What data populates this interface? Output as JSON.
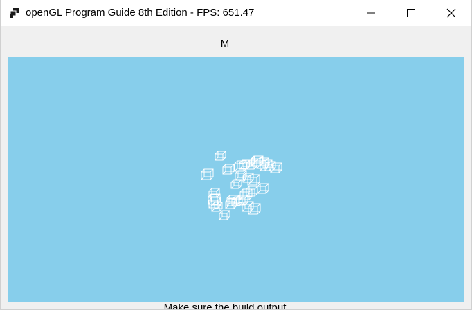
{
  "window": {
    "title": "openGL Program Guide 8th Edition - FPS: 651.47",
    "app_icon": "window-app-icon",
    "controls": {
      "minimize_icon": "minimize-icon",
      "maximize_icon": "maximize-icon",
      "close_icon": "close-icon"
    }
  },
  "main": {
    "label": "M",
    "viewport_background": "#87ceeb",
    "object_color": "#ffffff",
    "object_count": 30,
    "bottom_text": "Make sure the build output"
  }
}
